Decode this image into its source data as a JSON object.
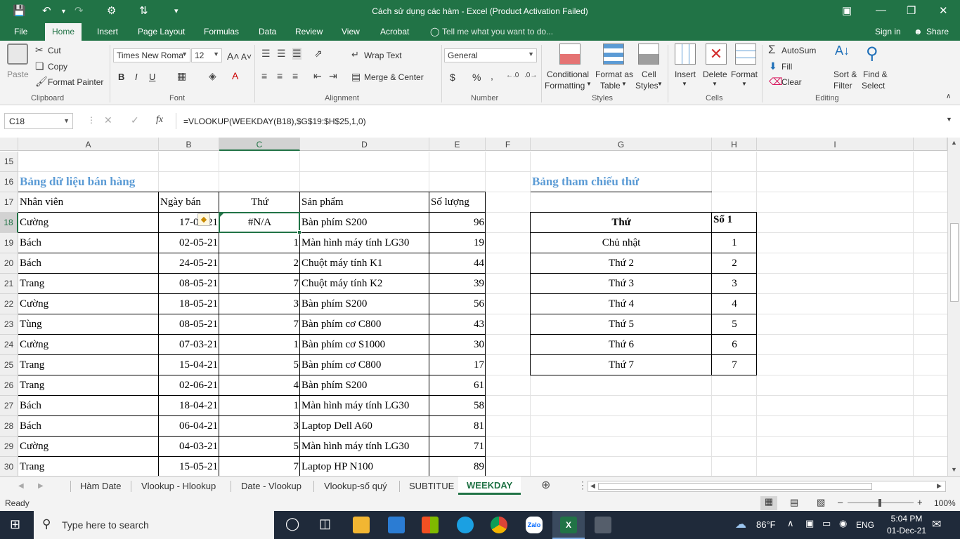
{
  "titlebar": {
    "title": "Cách sử dụng các hàm - Excel (Product Activation Failed)"
  },
  "tabs": [
    "File",
    "Home",
    "Insert",
    "Page Layout",
    "Formulas",
    "Data",
    "Review",
    "View",
    "Acrobat"
  ],
  "tell_me": "Tell me what you want to do...",
  "signin": "Sign in",
  "share": "Share",
  "ribbon": {
    "clipboard": {
      "paste": "Paste",
      "cut": "Cut",
      "copy": "Copy",
      "format_painter": "Format Painter",
      "label": "Clipboard"
    },
    "font": {
      "name": "Times New Roma",
      "size": "12",
      "bold": "B",
      "italic": "I",
      "underline": "U",
      "label": "Font"
    },
    "alignment": {
      "wrap_text": "Wrap Text",
      "merge_center": "Merge & Center",
      "label": "Alignment"
    },
    "number": {
      "format": "General",
      "currency": "$",
      "percent": "%",
      "comma": ",",
      "label": "Number"
    },
    "styles": {
      "conditional": "Conditional",
      "conditional2": "Formatting",
      "format_as": "Format as",
      "format_as2": "Table",
      "cell": "Cell",
      "cell2": "Styles",
      "label": "Styles"
    },
    "cells": {
      "insert": "Insert",
      "delete": "Delete",
      "format": "Format",
      "label": "Cells"
    },
    "editing": {
      "autosum": "AutoSum",
      "fill": "Fill",
      "clear": "Clear",
      "sort": "Sort &",
      "sort2": "Filter",
      "find": "Find &",
      "find2": "Select",
      "label": "Editing"
    }
  },
  "formula_bar": {
    "name_box": "C18",
    "fx": "fx",
    "formula": "=VLOOKUP(WEEKDAY(B18),$G$19:$H$25,1,0)"
  },
  "columns": [
    "A",
    "B",
    "C",
    "D",
    "E",
    "F",
    "G",
    "H",
    "I"
  ],
  "rows": [
    "15",
    "16",
    "17",
    "18",
    "19",
    "20",
    "21",
    "22",
    "23",
    "24",
    "25",
    "26",
    "27",
    "28",
    "29",
    "30"
  ],
  "sheet": {
    "main_title": "Bảng dữ liệu bán hàng",
    "ref_title": "Bảng tham chiếu thứ",
    "headers": [
      "Nhân viên",
      "Ngày bán",
      "Thứ",
      "Sản phẩm",
      "Số lượng"
    ],
    "data": [
      [
        "Cường",
        "17-04-21",
        "#N/A",
        "Bàn phím S200",
        "96"
      ],
      [
        "Bách",
        "02-05-21",
        "1",
        "Màn hình máy tính LG30",
        "19"
      ],
      [
        "Bách",
        "24-05-21",
        "2",
        "Chuột máy tính K1",
        "44"
      ],
      [
        "Trang",
        "08-05-21",
        "7",
        "Chuột máy tính K2",
        "39"
      ],
      [
        "Cường",
        "18-05-21",
        "3",
        "Bàn phím S200",
        "56"
      ],
      [
        "Tùng",
        "08-05-21",
        "7",
        "Bàn phím cơ C800",
        "43"
      ],
      [
        "Cường",
        "07-03-21",
        "1",
        "Bàn phím cơ S1000",
        "30"
      ],
      [
        "Trang",
        "15-04-21",
        "5",
        "Bàn phím cơ C800",
        "17"
      ],
      [
        "Trang",
        "02-06-21",
        "4",
        "Bàn phím S200",
        "61"
      ],
      [
        "Bách",
        "18-04-21",
        "1",
        "Màn hình máy tính LG30",
        "58"
      ],
      [
        "Bách",
        "06-04-21",
        "3",
        "Laptop Dell A60",
        "81"
      ],
      [
        "Cường",
        "04-03-21",
        "5",
        "Màn hình máy tính LG30",
        "71"
      ],
      [
        "Trang",
        "15-05-21",
        "7",
        "Laptop HP N100",
        "89"
      ]
    ],
    "ref_headers": [
      "Thứ",
      "Số 1"
    ],
    "ref_data": [
      [
        "Chủ nhật",
        "1"
      ],
      [
        "Thứ 2",
        "2"
      ],
      [
        "Thứ 3",
        "3"
      ],
      [
        "Thứ 4",
        "4"
      ],
      [
        "Thứ 5",
        "5"
      ],
      [
        "Thứ 6",
        "6"
      ],
      [
        "Thứ 7",
        "7"
      ]
    ]
  },
  "sheet_tabs": [
    "Hàm Date",
    "Vlookup - Hlookup",
    "Date - Vlookup",
    "Vlookup-số quý",
    "SUBTITUE",
    "WEEKDAY"
  ],
  "status": {
    "ready": "Ready",
    "zoom": "100%"
  },
  "taskbar": {
    "search": "Type here to search",
    "weather": "86°F",
    "lang": "ENG",
    "time": "5:04 PM",
    "date": "01-Dec-21"
  },
  "colors": {
    "excel_green": "#217346",
    "title_blue": "#5b9bd5"
  }
}
